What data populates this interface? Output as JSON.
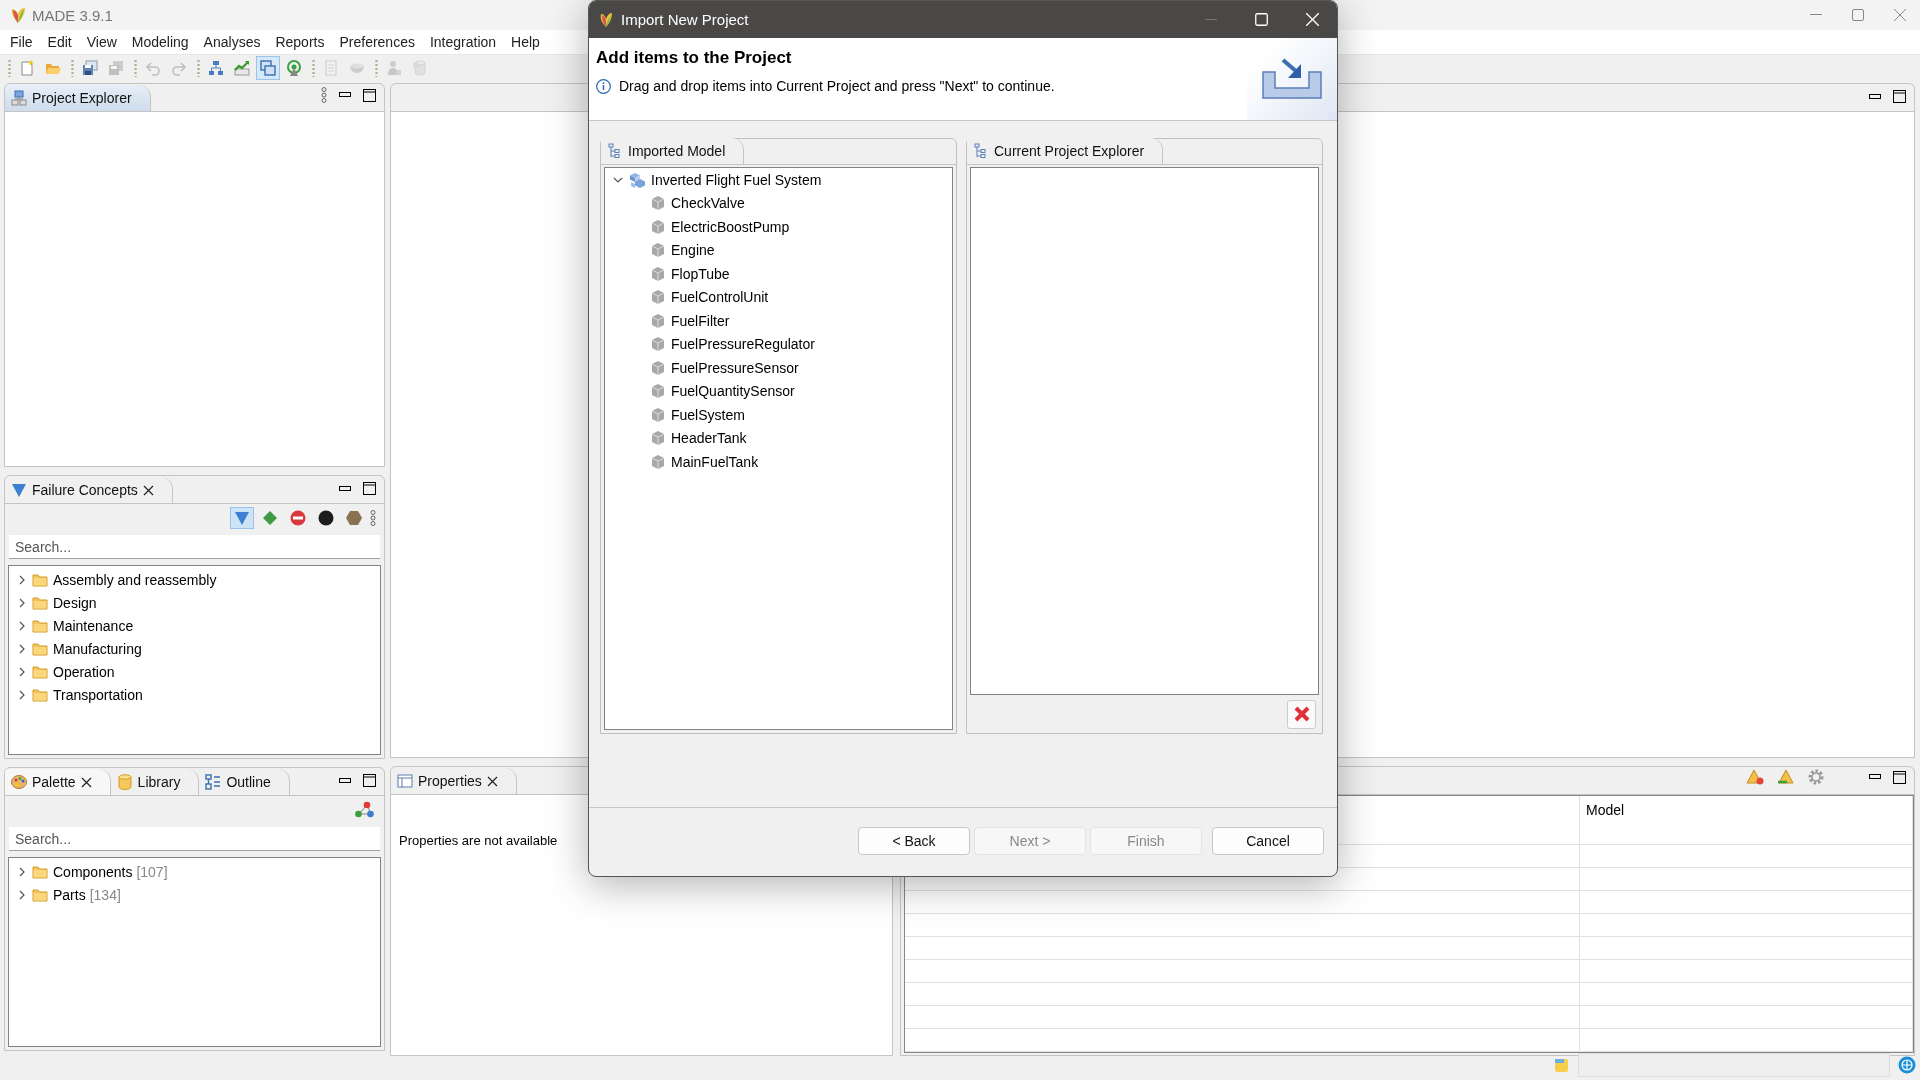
{
  "app": {
    "title": "MADE 3.9.1"
  },
  "menu": [
    "File",
    "Edit",
    "View",
    "Modeling",
    "Analyses",
    "Reports",
    "Preferences",
    "Integration",
    "Help"
  ],
  "toolbar": [
    {
      "buttons": [
        {
          "kind": "new",
          "disabled": false,
          "selected": false
        },
        {
          "kind": "open",
          "disabled": false,
          "selected": false
        }
      ]
    },
    {
      "buttons": [
        {
          "kind": "save",
          "disabled": false,
          "selected": false
        },
        {
          "kind": "save-all",
          "disabled": true,
          "selected": false
        }
      ]
    },
    {
      "buttons": [
        {
          "kind": "undo",
          "disabled": true,
          "selected": false
        },
        {
          "kind": "redo",
          "disabled": true,
          "selected": false
        }
      ]
    },
    {
      "buttons": [
        {
          "kind": "hierarchy",
          "disabled": false,
          "selected": false
        },
        {
          "kind": "chart",
          "disabled": false,
          "selected": false
        },
        {
          "kind": "window",
          "disabled": false,
          "selected": true
        },
        {
          "kind": "radar",
          "disabled": false,
          "selected": false
        }
      ]
    },
    {
      "buttons": [
        {
          "kind": "report",
          "disabled": true,
          "selected": false
        },
        {
          "kind": "bowl",
          "disabled": true,
          "selected": false
        }
      ]
    },
    {
      "buttons": [
        {
          "kind": "person",
          "disabled": true,
          "selected": false
        },
        {
          "kind": "cylinder",
          "disabled": true,
          "selected": false
        }
      ]
    }
  ],
  "project_explorer": {
    "title": "Project Explorer",
    "focused": true
  },
  "failure_concepts": {
    "title": "Failure Concepts",
    "focused": false,
    "filters": [
      {
        "kind": "triangle",
        "selected": true
      },
      {
        "kind": "diamond",
        "selected": false
      },
      {
        "kind": "no-entry",
        "selected": false
      },
      {
        "kind": "circle",
        "selected": false
      },
      {
        "kind": "hexagon",
        "selected": false
      }
    ],
    "search": {
      "placeholder": "Search..."
    },
    "tree": [
      {
        "label": "Assembly and reassembly",
        "expanded": false
      },
      {
        "label": "Design",
        "expanded": false
      },
      {
        "label": "Maintenance",
        "expanded": false
      },
      {
        "label": "Manufacturing",
        "expanded": false
      },
      {
        "label": "Operation",
        "expanded": false
      },
      {
        "label": "Transportation",
        "expanded": false
      }
    ]
  },
  "palette": {
    "tabs": [
      {
        "kind": "palette",
        "label": "Palette",
        "selected": true
      },
      {
        "kind": "library",
        "label": "Library",
        "selected": false
      },
      {
        "kind": "outline",
        "label": "Outline",
        "selected": false
      }
    ],
    "search": {
      "placeholder": "Search..."
    },
    "tree": [
      {
        "label": "Components",
        "count": "[107]",
        "expanded": false
      },
      {
        "label": "Parts",
        "count": "[134]",
        "expanded": false
      }
    ]
  },
  "properties": {
    "title": "Properties",
    "message": "Properties are not available"
  },
  "table": {
    "columns": [
      "Model"
    ]
  },
  "dialog": {
    "title": "Import New Project",
    "heading": "Add items to the Project",
    "info": "Drag and drop items into Current Project and press \"Next\" to continue.",
    "left_panel": {
      "title": "Imported Model",
      "tree": [
        {
          "label": "Inverted Flight Fuel System",
          "expanded": true,
          "children": [
            {
              "label": "CheckValve"
            },
            {
              "label": "ElectricBoostPump"
            },
            {
              "label": "Engine"
            },
            {
              "label": "FlopTube"
            },
            {
              "label": "FuelControlUnit"
            },
            {
              "label": "FuelFilter"
            },
            {
              "label": "FuelPressureRegulator"
            },
            {
              "label": "FuelPressureSensor"
            },
            {
              "label": "FuelQuantitySensor"
            },
            {
              "label": "FuelSystem"
            },
            {
              "label": "HeaderTank"
            },
            {
              "label": "MainFuelTank"
            }
          ]
        }
      ]
    },
    "right_panel": {
      "title": "Current Project Explorer"
    },
    "buttons": [
      {
        "label": "< Back",
        "disabled": false
      },
      {
        "label": "Next >",
        "disabled": true
      },
      {
        "label": "Finish",
        "disabled": true
      },
      {
        "label": "Cancel",
        "disabled": false
      }
    ]
  }
}
